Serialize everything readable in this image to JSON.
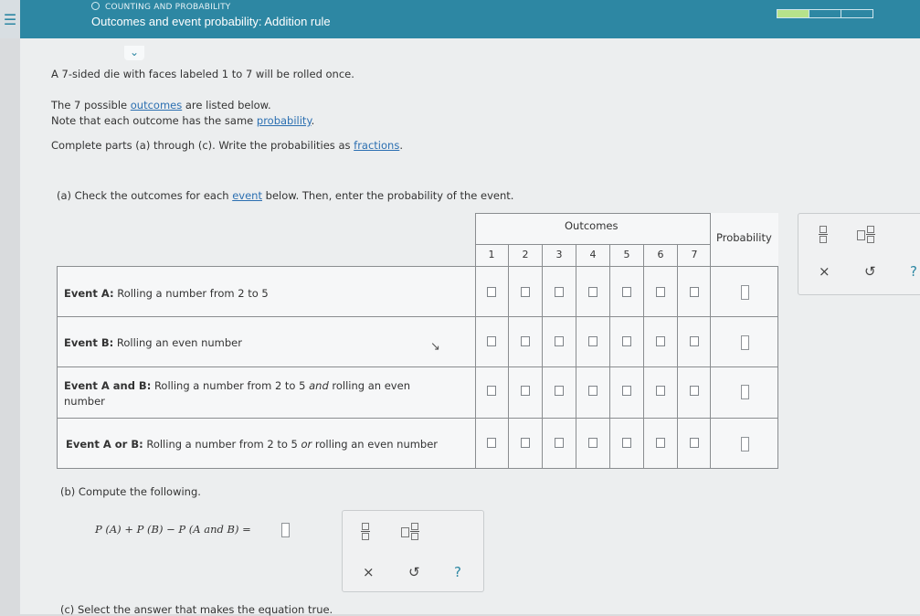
{
  "header": {
    "menu_icon": "hamburger-icon",
    "topic": "COUNTING AND PROBABILITY",
    "title": "Outcomes and event probability: Addition rule",
    "progress_filled_segments": 1,
    "progress_total_segments": 3
  },
  "intro": {
    "line1": "A 7-sided die with faces labeled 1 to 7 will be rolled once.",
    "line2_pre": "The 7 possible ",
    "line2_link": "outcomes",
    "line2_post": " are listed below.",
    "line3_pre": "Note that each outcome has the same ",
    "line3_link": "probability",
    "line3_post": ".",
    "line4_pre": "Complete parts (a) through (c). Write the probabilities as ",
    "line4_link": "fractions",
    "line4_post": "."
  },
  "part_a": {
    "prompt_pre": "(a) Check the outcomes for each ",
    "prompt_link": "event",
    "prompt_post": " below. Then, enter the probability of the event.",
    "outcomes_header": "Outcomes",
    "probability_header": "Probability",
    "outcomes": [
      "1",
      "2",
      "3",
      "4",
      "5",
      "6",
      "7"
    ],
    "events": [
      {
        "label": "Event A:",
        "text": "Rolling a number from 2 to 5"
      },
      {
        "label": "Event B:",
        "text": "Rolling an even number"
      },
      {
        "label": "Event A and B:",
        "text_pre": "Rolling a number from 2 to 5 ",
        "text_em": "and",
        "text_post": " rolling an even number"
      },
      {
        "label": "Event A or B:",
        "text_pre": "Rolling a number from 2 to 5 ",
        "text_em": "or",
        "text_post": " rolling an even number"
      }
    ]
  },
  "part_b": {
    "prompt": "(b) Compute the following.",
    "formula": "P (A) + P (B) − P (A and B) ="
  },
  "part_c": {
    "prompt": "(c) Select the answer that makes the equation true."
  },
  "palette": {
    "fraction_icon": "fraction-icon",
    "mixed_icon": "mixed-number-icon",
    "clear_symbol": "×",
    "undo_symbol": "↺",
    "help_symbol": "?"
  }
}
